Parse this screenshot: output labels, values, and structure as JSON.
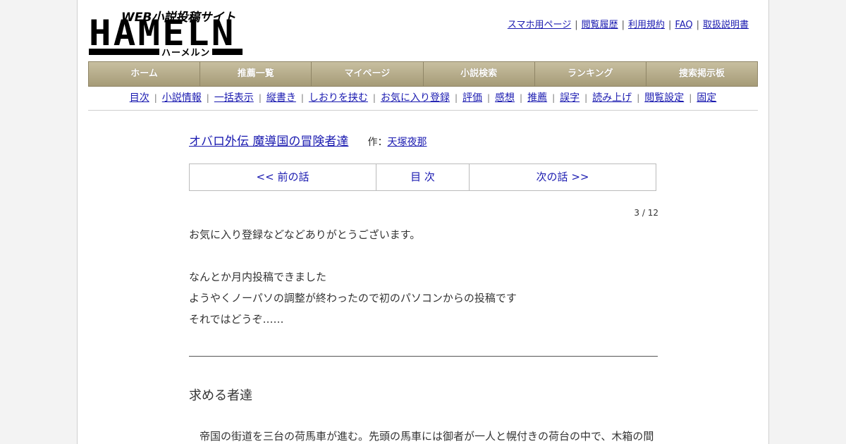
{
  "logo": {
    "tagline": "WEB小説投稿サイト",
    "word": "HAMELN",
    "kana": "ハーメルン"
  },
  "top_links": [
    "スマホ用ページ",
    "閲覧履歴",
    "利用規約",
    "FAQ",
    "取扱説明書"
  ],
  "main_nav": [
    "ホーム",
    "推薦一覧",
    "マイページ",
    "小説検索",
    "ランキング",
    "捜索掲示板"
  ],
  "sub_nav": [
    "目次",
    "小説情報",
    "一括表示",
    "縦書き",
    "しおりを挟む",
    "お気に入り登録",
    "評価",
    "感想",
    "推薦",
    "誤字",
    "読み上げ",
    "閲覧設定",
    "固定"
  ],
  "novel": {
    "title": "オバロ外伝 魔導国の冒険者達",
    "author_label": "作：",
    "author": "天塚夜那"
  },
  "episode_nav": {
    "prev": "<< 前の話",
    "toc": "目 次",
    "next": "次の話 >>"
  },
  "progress": "3 / 12",
  "preface": [
    "お気に入り登録などなどありがとうございます。",
    "",
    "なんとか月内投稿できました",
    "ようやくノーパソの調整が終わったので初のパソコンからの投稿です",
    "それではどうぞ……"
  ],
  "chapter_title": "求める者達",
  "body_first_line": "　帝国の街道を三台の荷馬車が進む。先頭の馬車には御者が一人と幌付きの荷台の中で、木箱の間"
}
